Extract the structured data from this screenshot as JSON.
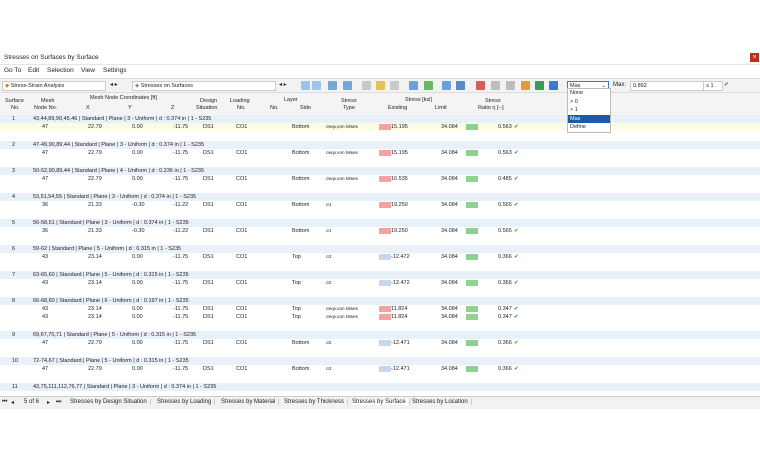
{
  "window": {
    "title": "Stresses on Surfaces by Surface"
  },
  "menu": [
    "Go To",
    "Edit",
    "Selection",
    "View",
    "Settings"
  ],
  "toolbar": {
    "analysis": "Stress-Strain Analysis",
    "result_type": "Stresses on Surfaces",
    "filter_value": "Max",
    "max_label": "Max:",
    "max_value": "0.892",
    "compare": "≤ 1"
  },
  "filter_options": [
    "None",
    "> 0",
    "> 1",
    "Max",
    "Define"
  ],
  "filter_selected": 3,
  "columns": {
    "surface": "Surface",
    "surface_no": "No.",
    "mesh": "Mesh",
    "mesh_no": "Node No.",
    "coords": "Mesh Node Coordinates [ft]",
    "x": "X",
    "y": "Y",
    "z": "Z",
    "design": "Design",
    "design2": "Situation",
    "loading": "Loading",
    "loading2": "No.",
    "layer": "Layer",
    "layer_no": "No.",
    "layer_side": "Side",
    "stress": "Stress",
    "stress2": "Type",
    "stress_ksi": "Stress [ksi]",
    "existing": "Existing",
    "limit": "Limit",
    "ratio": "Stress",
    "ratio2": "Ratio η [--]"
  },
  "groups": [
    {
      "no": "1",
      "desc": "43,44,89,90,45,46 | Standard | Plane | 3 - Uniform | d : 0.374 in | 1 - S235",
      "rows": [
        {
          "node": "47",
          "x": "22.79",
          "y": "0.00",
          "z": "-11.75",
          "ds": "DS1",
          "lc": "CO1",
          "side": "Bottom",
          "type": "σeqv,von Mises",
          "existing": "15.195",
          "limit": "34.084",
          "ratio": "0.563",
          "neg": false
        }
      ]
    },
    {
      "no": "2",
      "desc": "47-49,90,89,44 | Standard | Plane | 3 - Uniform | d : 0.374 in | 1 - S235",
      "rows": [
        {
          "node": "47",
          "x": "22.79",
          "y": "0.00",
          "z": "-11.75",
          "ds": "DS1",
          "lc": "CO1",
          "side": "Bottom",
          "type": "σeqv,von Mises",
          "existing": "15.195",
          "limit": "34.084",
          "ratio": "0.563",
          "neg": false
        }
      ]
    },
    {
      "no": "3",
      "desc": "50-52,90,89,44 | Standard | Plane | 4 - Uniform | d : 0.236 in | 1 - S235",
      "rows": [
        {
          "node": "47",
          "x": "22.79",
          "y": "0.00",
          "z": "-11.75",
          "ds": "DS1",
          "lc": "CO1",
          "side": "Bottom",
          "type": "σeqv,von Mises",
          "existing": "16.535",
          "limit": "34.084",
          "ratio": "0.485",
          "neg": false
        }
      ]
    },
    {
      "no": "4",
      "desc": "53,51,54,55 | Standard | Plane | 3 - Uniform | d : 0.374 in | 1 - S235",
      "rows": [
        {
          "node": "36",
          "x": "21.33",
          "y": "-0.30",
          "z": "-11.22",
          "ds": "DS1",
          "lc": "CO1",
          "side": "Bottom",
          "type": "σ1",
          "existing": "19.250",
          "limit": "34.084",
          "ratio": "0.565",
          "neg": false
        }
      ]
    },
    {
      "no": "5",
      "desc": "56-58,51 | Standard | Plane | 3 - Uniform | d : 0.374 in | 1 - S235",
      "rows": [
        {
          "node": "36",
          "x": "21.33",
          "y": "-0.30",
          "z": "-11.22",
          "ds": "DS1",
          "lc": "CO1",
          "side": "Bottom",
          "type": "σ1",
          "existing": "19.250",
          "limit": "34.084",
          "ratio": "0.565",
          "neg": false
        }
      ]
    },
    {
      "no": "6",
      "desc": "59-62 | Standard | Plane | 5 - Uniform | d : 0.315 in | 1 - S235",
      "rows": [
        {
          "node": "43",
          "x": "23.14",
          "y": "0.00",
          "z": "-11.75",
          "ds": "DS1",
          "lc": "CO1",
          "side": "Top",
          "type": "σ2",
          "existing": "-12.472",
          "limit": "34.084",
          "ratio": "0.366",
          "neg": true
        }
      ]
    },
    {
      "no": "7",
      "desc": "63-65,60 | Standard | Plane | 5 - Uniform | d : 0.315 in | 1 - S235",
      "rows": [
        {
          "node": "43",
          "x": "23.14",
          "y": "0.00",
          "z": "-11.75",
          "ds": "DS1",
          "lc": "CO1",
          "side": "Top",
          "type": "σ2",
          "existing": "-12.472",
          "limit": "34.084",
          "ratio": "0.366",
          "neg": true
        }
      ]
    },
    {
      "no": "8",
      "desc": "66-68,60 | Standard | Plane | 6 - Uniform | d : 0.197 in | 1 - S235",
      "rows": [
        {
          "node": "43",
          "x": "23.14",
          "y": "0.00",
          "z": "-11.75",
          "ds": "DS1",
          "lc": "CO1",
          "side": "Top",
          "type": "σeqv,von Mises",
          "existing": "11.824",
          "limit": "34.084",
          "ratio": "0.347",
          "neg": false
        },
        {
          "node": "43",
          "x": "23.14",
          "y": "0.00",
          "z": "-11.75",
          "ds": "DS1",
          "lc": "CO1",
          "side": "Top",
          "type": "σeqv,von Mises",
          "existing": "11.824",
          "limit": "34.084",
          "ratio": "0.347",
          "neg": false
        }
      ]
    },
    {
      "no": "9",
      "desc": "69,67,70,71 | Standard | Plane | 5 - Uniform | d : 0.315 in | 1 - S235",
      "rows": [
        {
          "node": "47",
          "x": "22.79",
          "y": "0.00",
          "z": "-11.75",
          "ds": "DS1",
          "lc": "CO1",
          "side": "Bottom",
          "type": "σ2",
          "existing": "-12.471",
          "limit": "34.084",
          "ratio": "0.366",
          "neg": true
        }
      ]
    },
    {
      "no": "10",
      "desc": "72-74,67 | Standard | Plane | 5 - Uniform | d : 0.315 in | 1 - S235",
      "rows": [
        {
          "node": "47",
          "x": "22.79",
          "y": "0.00",
          "z": "-11.75",
          "ds": "DS1",
          "lc": "CO1",
          "side": "Bottom",
          "type": "σ2",
          "existing": "-12.471",
          "limit": "34.084",
          "ratio": "0.366",
          "neg": true
        }
      ]
    },
    {
      "no": "11",
      "desc": "43,75,111,112,76,77 | Standard | Plane | 3 - Uniform | d : 0.374 in | 1 - S235",
      "rows": []
    }
  ],
  "pager": {
    "text": "5 of 6"
  },
  "tabs": [
    "Stresses by Design Situation",
    "Stresses by Loading",
    "Stresses by Material",
    "Stresses by Thickness",
    "Stresses by Surface",
    "Stresses by Location"
  ],
  "active_tab": 4,
  "colors": {
    "positive_bar": "#f3a3a3",
    "negative_bar": "#c9d6f0",
    "ok_bar": "#8fd18f",
    "group_bg": "#eaf0f7",
    "dropdown_selected": "#1e5aa8"
  }
}
